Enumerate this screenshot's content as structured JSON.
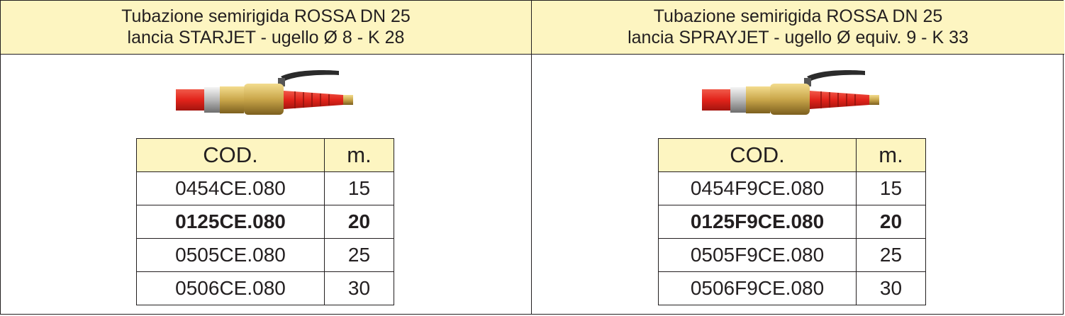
{
  "left": {
    "title_line1": "Tubazione semirigida ROSSA DN 25",
    "title_line2": "lancia STARJET - ugello Ø 8 - K 28",
    "table": {
      "headers": [
        "COD.",
        "m."
      ],
      "rows": [
        [
          "0454CE.080",
          "15"
        ],
        [
          "0125CE.080",
          "20"
        ],
        [
          "0505CE.080",
          "25"
        ],
        [
          "0506CE.080",
          "30"
        ]
      ]
    }
  },
  "right": {
    "title_line1": "Tubazione semirigida ROSSA DN 25",
    "title_line2": "lancia SPRAYJET - ugello Ø equiv. 9 - K 33",
    "table": {
      "headers": [
        "COD.",
        "m."
      ],
      "rows": [
        [
          "0454F9CE.080",
          "15"
        ],
        [
          "0125F9CE.080",
          "20"
        ],
        [
          "0505F9CE.080",
          "25"
        ],
        [
          "0506F9CE.080",
          "30"
        ]
      ]
    }
  },
  "colors": {
    "header_bg": "#fdf5c1",
    "border": "#231f20",
    "hose_red": "#e2231a",
    "brass": "#c9a64a"
  },
  "icons": [
    "nozzle-valve-icon"
  ]
}
